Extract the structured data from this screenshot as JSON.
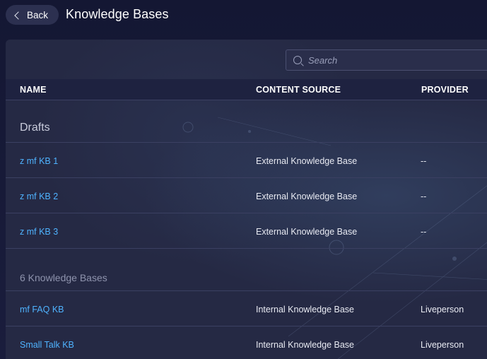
{
  "header": {
    "back_label": "Back",
    "title": "Knowledge Bases"
  },
  "search": {
    "placeholder": "Search",
    "value": ""
  },
  "table": {
    "columns": [
      "NAME",
      "CONTENT SOURCE",
      "PROVIDER"
    ],
    "drafts_label": "Drafts",
    "drafts": [
      {
        "name": "z mf KB 1",
        "source": "External Knowledge Base",
        "provider": "--"
      },
      {
        "name": "z mf KB 2",
        "source": "External Knowledge Base",
        "provider": "--"
      },
      {
        "name": "z mf KB 3",
        "source": "External Knowledge Base",
        "provider": "--"
      }
    ],
    "kb_count_label": "6 Knowledge Bases",
    "kbs": [
      {
        "name": "mf FAQ KB",
        "source": "Internal Knowledge Base",
        "provider": "Liveperson"
      },
      {
        "name": "Small Talk KB",
        "source": "Internal Knowledge Base",
        "provider": "Liveperson"
      }
    ]
  },
  "colors": {
    "background": "#141733",
    "panel": "#252944",
    "link": "#4fb3ff"
  }
}
